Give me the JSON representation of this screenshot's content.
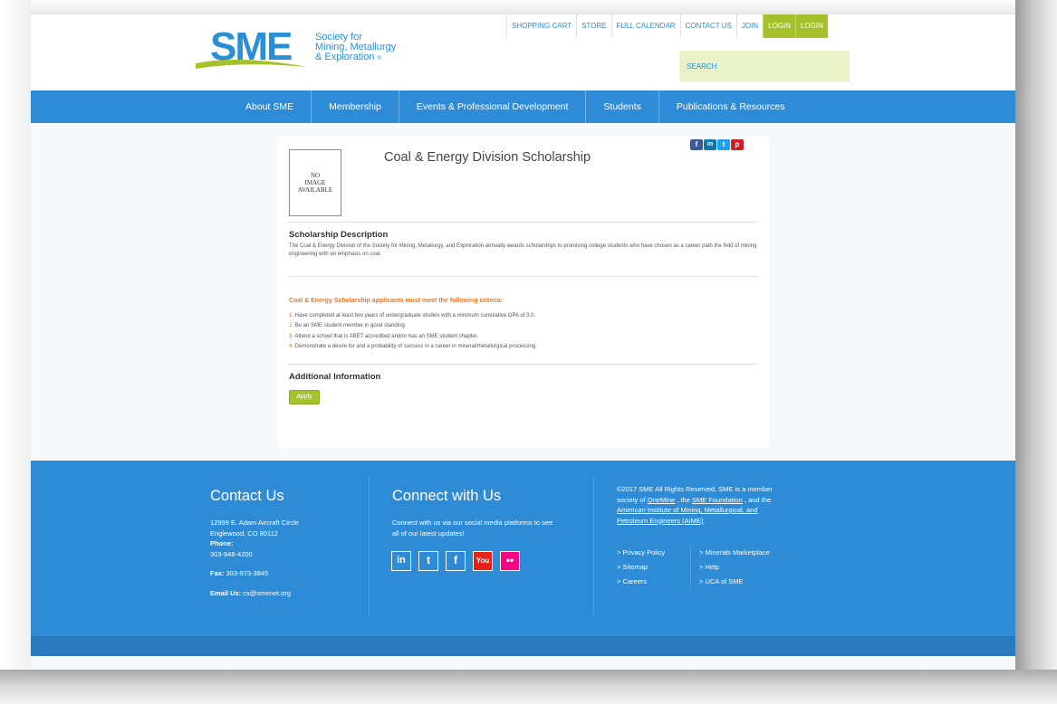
{
  "header": {
    "logo_text": "SME",
    "logo_lines": [
      "Society for",
      "Mining, Metallurgy",
      "& Exploration"
    ],
    "logo_mark": "®",
    "top_nav": [
      "SHOPPING CART",
      "STORE",
      "FULL CALENDAR",
      "CONTACT US",
      "JOIN",
      "LOGIN",
      "LOGIN"
    ],
    "search_placeholder": "SEARCH",
    "colors": {
      "brand_blue": "#2e8bd6",
      "brand_green": "#a6c22a"
    }
  },
  "main_nav": [
    "About SME",
    "Membership",
    "Events & Professional Development",
    "Students",
    "Publications & Resources"
  ],
  "scholarship": {
    "no_image_lines": [
      "NO",
      "IMAGE",
      "AVAILABLE"
    ],
    "title": "Coal & Energy Division Scholarship",
    "social_icons": [
      "facebook-icon",
      "linkedin-icon",
      "twitter-icon",
      "pinterest-icon"
    ],
    "description_heading": "Scholarship Description",
    "description": "The Coal & Energy Division of the Society for Mining, Metallurgy, and Exploration annually awards scholarships to promising college students who have chosen as a career path the field of mining engineering with an emphasis on coal.",
    "criteria_heading": "Coal & Energy Scholarship applicants must meet the following criteria:",
    "criteria": [
      {
        "num": "1.",
        "text": " Have completed at least two years of undergraduate studies with a minimum cumulative GPA of 3.0."
      },
      {
        "num": "2.",
        "text": " Be an SME student member in good standing."
      },
      {
        "num": "3.",
        "text": " Attend a school that is ABET accredited and/or has an SME student chapter."
      },
      {
        "num": "4.",
        "text": " Demonstrate a desire for and a probability of success in a career in mineral/metallurgical processing."
      }
    ],
    "additional_heading": "Additional Information",
    "apply_label": "Apply"
  },
  "footer": {
    "contact_heading": "Contact Us",
    "address_line1": "12999 E. Adam Aircraft Circle",
    "address_line2": "Englewood, CO 80112",
    "phone_label": "Phone:",
    "phone": "303-948-4200",
    "fax_label": "Fax:",
    "fax": " 303-973-3845",
    "email_label": "Email Us:",
    "email": " cs@smenet.org",
    "connect_heading": "Connect with Us",
    "connect_text_1": "Connect with us via our social media platforms to see",
    "connect_text_2": "all of our latest updates!",
    "social_icons": [
      "linkedin-icon",
      "twitter-icon",
      "facebook-icon",
      "youtube-icon",
      "flickr-icon"
    ],
    "copyright_1": "©2017 SME All Rights Reserved. SME is a member",
    "copyright_2a": "society of ",
    "copyright_2b": "OneMine",
    "copyright_2c": " , the ",
    "copyright_2d": "SME Foundation",
    "copyright_2e": " , and the",
    "copyright_3": "American Institute of Mining, Metallurgical, and",
    "copyright_4": "Petroleum Engineers (AIME)",
    "copyright_4b": ".",
    "links_left": [
      "> Privacy Policy",
      "> Sitemap",
      "> Careers"
    ],
    "links_right": [
      "> Minerals Marketplace",
      "> Help",
      "> UCA of SME"
    ]
  }
}
